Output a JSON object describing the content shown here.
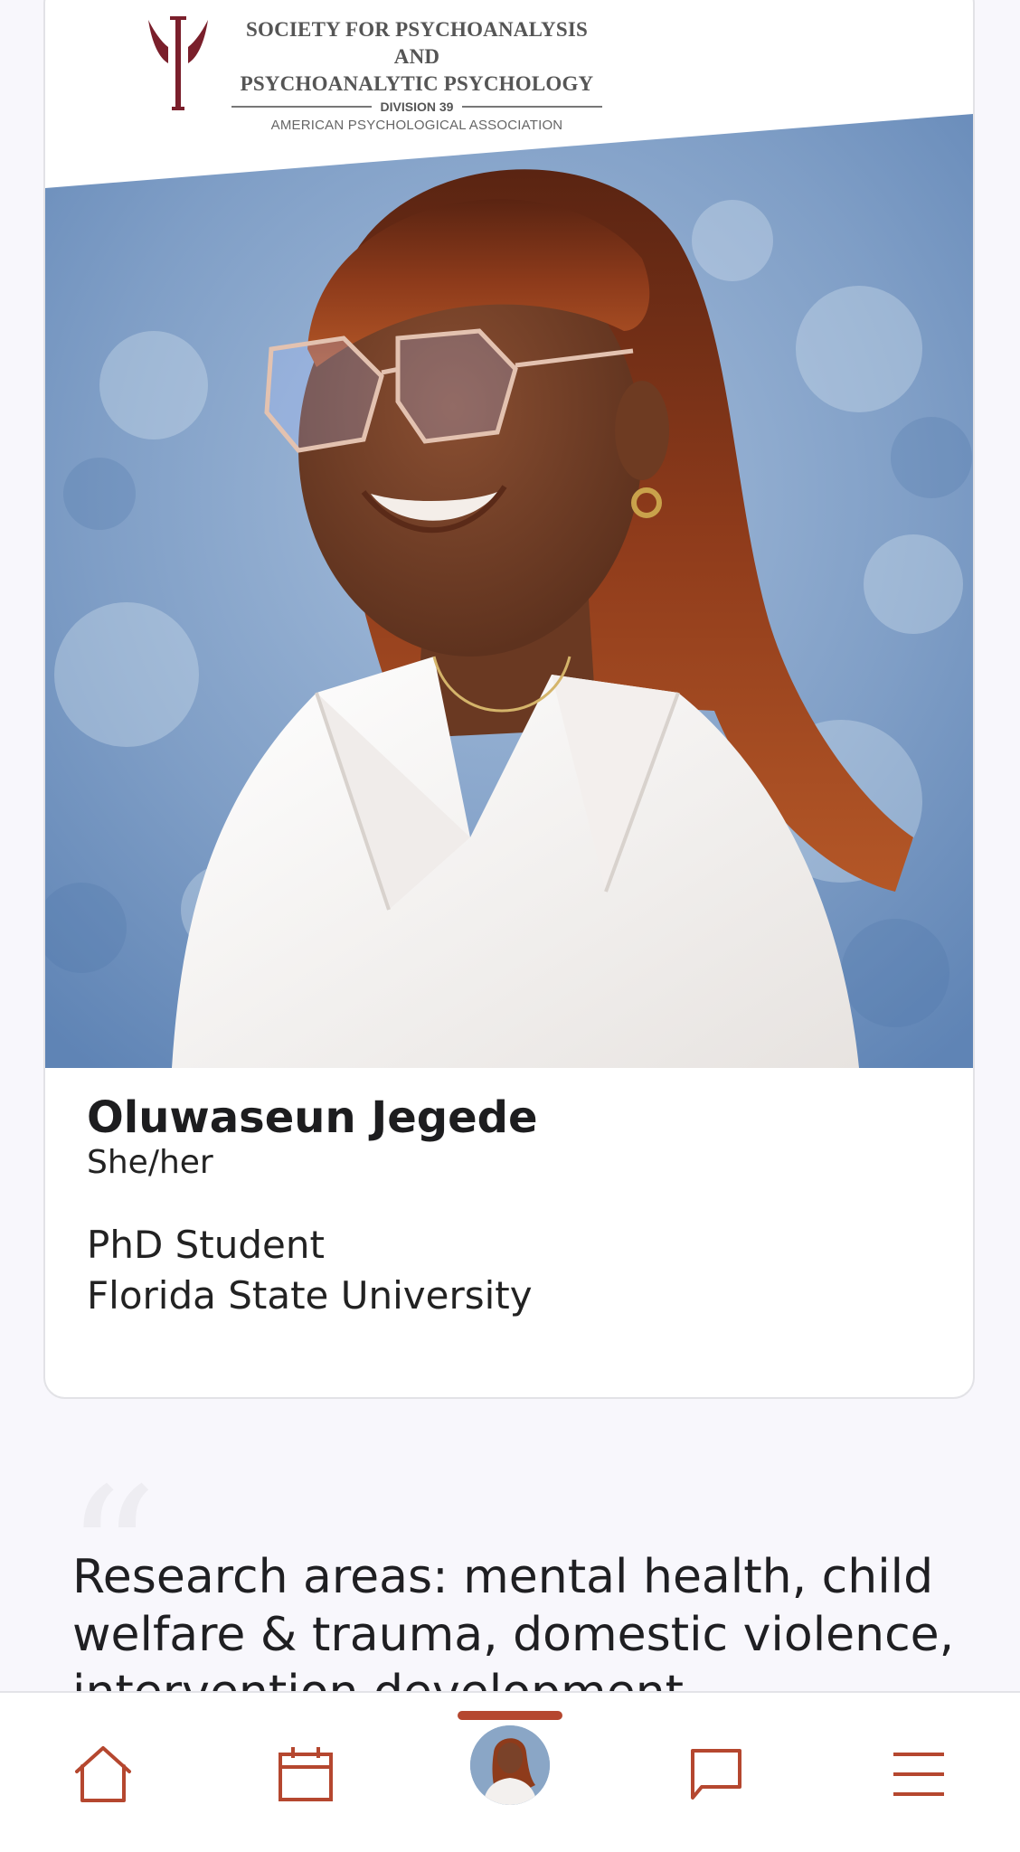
{
  "logo": {
    "line1": "SOCIETY FOR PSYCHOANALYSIS AND",
    "line2": "PSYCHOANALYTIC PSYCHOLOGY",
    "division": "DIVISION 39",
    "association": "AMERICAN PSYCHOLOGICAL ASSOCIATION"
  },
  "profile": {
    "name": "Oluwaseun Jegede",
    "pronouns": "She/her",
    "role": "PhD Student",
    "institution": "Florida State University"
  },
  "research": {
    "text": "Research areas: mental health, child welfare & trauma, domestic violence, intervention development"
  },
  "nav": {
    "items": [
      {
        "icon": "home-icon"
      },
      {
        "icon": "calendar-icon"
      },
      {
        "icon": "profile-avatar",
        "active": true
      },
      {
        "icon": "chat-icon"
      },
      {
        "icon": "menu-icon"
      }
    ]
  },
  "colors": {
    "accent": "#b5472f",
    "logo_maroon": "#7a1f2b",
    "background": "#f8f7fc",
    "card": "#ffffff",
    "photo_bg": "#7d9fc9"
  }
}
